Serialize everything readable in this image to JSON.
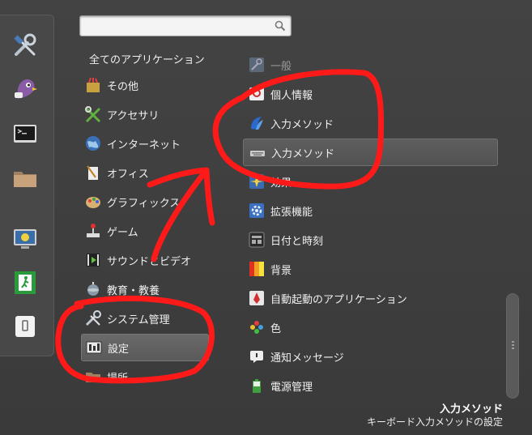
{
  "favorites": [
    {
      "icon": "tools-icon"
    },
    {
      "icon": "pidgin-icon"
    },
    {
      "icon": "terminal-icon"
    },
    {
      "icon": "folder-icon"
    },
    {
      "icon": "lock-screen-icon"
    },
    {
      "icon": "logout-icon"
    },
    {
      "icon": "shutdown-icon"
    }
  ],
  "search": {
    "placeholder": "",
    "value": ""
  },
  "categories_header": "全てのアプリケーション",
  "categories": [
    {
      "label": "その他",
      "icon": "other-icon"
    },
    {
      "label": "アクセサリ",
      "icon": "accessories-icon"
    },
    {
      "label": "インターネット",
      "icon": "internet-icon"
    },
    {
      "label": "オフィス",
      "icon": "office-icon"
    },
    {
      "label": "グラフィックス",
      "icon": "graphics-icon"
    },
    {
      "label": "ゲーム",
      "icon": "games-icon"
    },
    {
      "label": "サウンドとビデオ",
      "icon": "sound-video-icon"
    },
    {
      "label": "教育・教養",
      "icon": "education-icon"
    },
    {
      "label": "システム管理",
      "icon": "system-admin-icon"
    },
    {
      "label": "設定",
      "icon": "settings-icon"
    },
    {
      "label": "場所",
      "icon": "places-icon"
    }
  ],
  "apps": [
    {
      "label": "一般",
      "icon": "general-icon"
    },
    {
      "label": "個人情報",
      "icon": "personal-info-icon"
    },
    {
      "label": "入力メソッド",
      "icon": "input-method-icon"
    },
    {
      "label": "入力メソッド",
      "icon": "keyboard-icon"
    },
    {
      "label": "効果",
      "icon": "effects-icon"
    },
    {
      "label": "拡張機能",
      "icon": "extensions-icon"
    },
    {
      "label": "日付と時刻",
      "icon": "date-time-icon"
    },
    {
      "label": "背景",
      "icon": "background-icon"
    },
    {
      "label": "自動起動のアプリケーション",
      "icon": "startup-apps-icon"
    },
    {
      "label": "色",
      "icon": "color-icon"
    },
    {
      "label": "通知メッセージ",
      "icon": "notifications-icon"
    },
    {
      "label": "電源管理",
      "icon": "power-icon"
    }
  ],
  "description": {
    "title": "入力メソッド",
    "text": "キーボード入力メソッドの設定"
  },
  "colors": {
    "panel_bg": "#3d3d3d",
    "selection": "#5e5e5e",
    "annotation": "#ff1a1a"
  }
}
